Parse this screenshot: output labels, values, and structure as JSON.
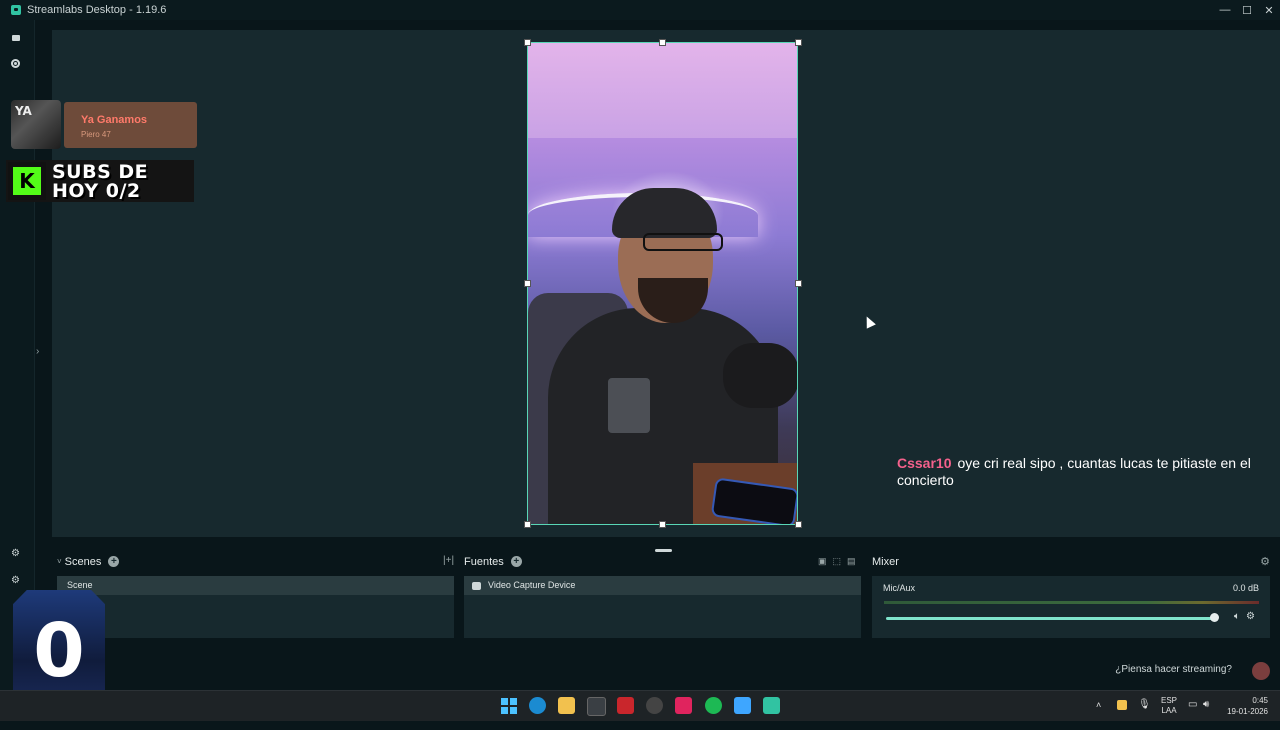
{
  "window": {
    "title": "Streamlabs Desktop - 1.19.6",
    "controls": {
      "minimize": "—",
      "maximize": "☐",
      "close": "✕"
    }
  },
  "left_sidebar": {
    "icons": [
      "camera-icon",
      "record-icon",
      "studio-mode-icon",
      "settings-gear-icon"
    ],
    "collapse_glyph": "›"
  },
  "preview": {
    "now_playing": {
      "thumb_text": "YA",
      "title": "Ya Ganamos",
      "artist": "Piero 47"
    },
    "subs_overlay": {
      "logo_letter": "K",
      "line1": "SUBS DE",
      "line2": "HOY 0/2"
    },
    "chat_message": {
      "user": "Cssar10",
      "text": "oye cri real sipo , cuantas lucas te pitiaste en el concierto"
    },
    "source_selected": "Video Capture Device"
  },
  "docks": {
    "scenes": {
      "header": "Scenes",
      "add": "+",
      "items": [
        "Scene"
      ]
    },
    "sources": {
      "header": "Fuentes",
      "add": "+",
      "items": [
        "Video Capture Device"
      ]
    },
    "mixer": {
      "header": "Mixer",
      "channels": [
        {
          "name": "Mic/Aux",
          "level": "0.0 dB",
          "volume_fraction": 0.98
        }
      ]
    }
  },
  "footer": {
    "stream_prompt": "¿Piensa hacer streaming?"
  },
  "badge_overlay": {
    "number": "0"
  },
  "taskbar": {
    "apps": [
      "windows-start-icon",
      "edge-icon",
      "file-explorer-icon",
      "excel-icon",
      "voicemeeter-icon",
      "chrome-icon",
      "tiktok-icon",
      "spotify-icon",
      "notepad-icon",
      "streamlabs-icon"
    ],
    "tray": {
      "language": "ESP",
      "layout": "LAA",
      "time": "0:45",
      "date": "19-01-2026"
    }
  },
  "colors": {
    "accent": "#31c3a2",
    "chat_user": "#f4618c",
    "now_playing_title": "#ff7a6a",
    "kick_green": "#53fc18"
  }
}
